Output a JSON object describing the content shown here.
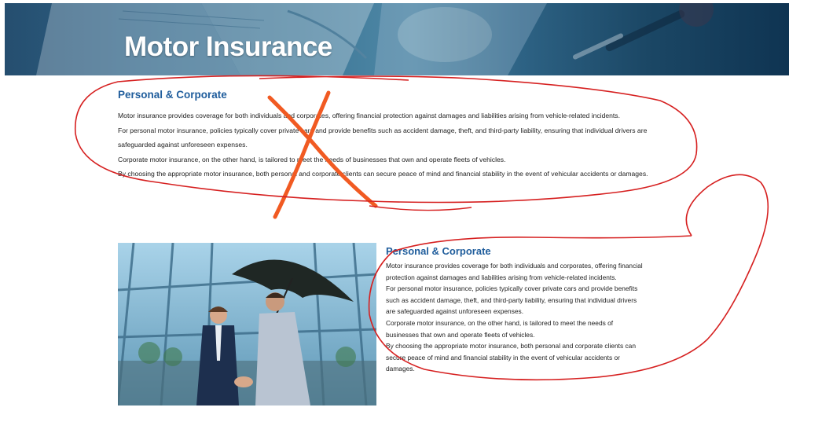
{
  "hero": {
    "title": "Motor Insurance"
  },
  "section_text": {
    "heading": "Personal & Corporate",
    "lines": [
      "Motor insurance provides coverage for both individuals and corporates, offering financial protection against damages and liabilities arising from vehicle-related incidents.",
      "For personal motor insurance, policies typically cover private cars and provide benefits such as accident damage, theft, and third-party liability, ensuring that individual drivers are safeguarded against unforeseen expenses.",
      "Corporate motor insurance, on the other hand, is tailored to meet the needs of businesses that own and operate fleets of vehicles.",
      "By choosing the appropriate motor insurance, both personal and corporate clients can secure peace of mind and financial stability in the event of vehicular accidents or damages."
    ]
  },
  "section_image": {
    "heading": "Personal & Corporate",
    "lines": [
      "Motor insurance provides coverage for both individuals and corporates, offering financial protection against damages and liabilities arising from vehicle-related incidents.",
      "For personal motor insurance, policies typically cover private cars and provide benefits such as accident damage, theft, and third-party liability, ensuring that individual drivers are safeguarded against unforeseen expenses.",
      "Corporate motor insurance, on the other hand, is tailored to meet the needs of businesses that own and operate fleets of vehicles.",
      "By choosing the appropriate motor insurance, both personal and corporate clients can secure peace of mind and financial stability in the event of vehicular accidents or damages."
    ],
    "image": "two-businessmen-handshake-under-umbrella-photo"
  },
  "annotations": {
    "strike_color": "#f15a22",
    "circle_color": "#d62020"
  }
}
